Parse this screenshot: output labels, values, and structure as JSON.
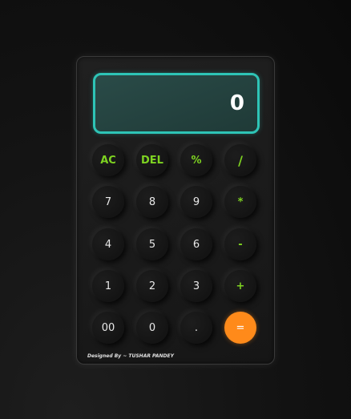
{
  "display": {
    "value": "0"
  },
  "keys": {
    "ac": "AC",
    "del": "DEL",
    "percent": "%",
    "divide": "/",
    "seven": "7",
    "eight": "8",
    "nine": "9",
    "multiply": "*",
    "four": "4",
    "five": "5",
    "six": "6",
    "minus": "-",
    "one": "1",
    "two": "2",
    "three": "3",
    "plus": "+",
    "double_zero": "00",
    "zero": "0",
    "dot": ".",
    "equals": "="
  },
  "footer": {
    "credit": "Designed By ~ TUSHAR PANDEY"
  },
  "colors": {
    "accent_teal": "#2ec4b6",
    "operator_green": "#7ed321",
    "equals_orange": "#ff8a1a"
  }
}
